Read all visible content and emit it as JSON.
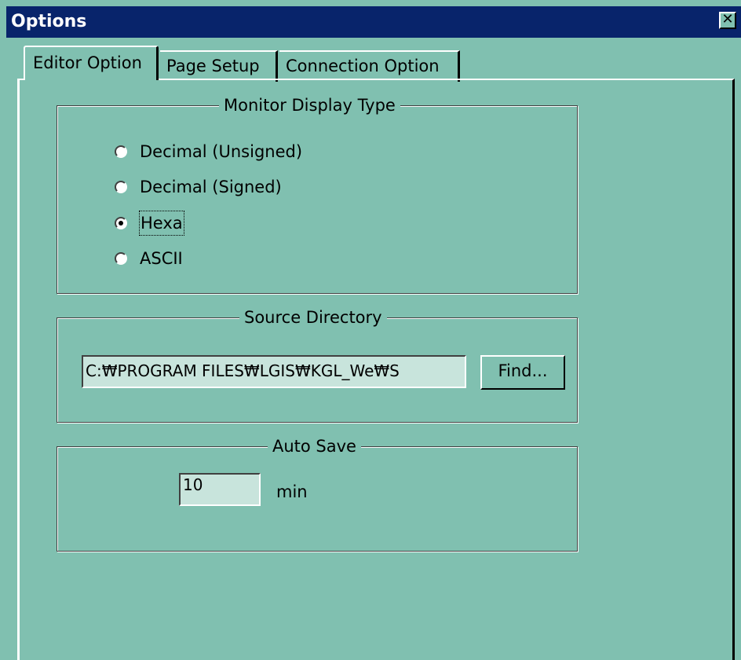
{
  "window": {
    "title": "Options"
  },
  "tabs": [
    {
      "label": "Editor Option",
      "active": true
    },
    {
      "label": "Page Setup",
      "active": false
    },
    {
      "label": "Connection Option",
      "active": false
    }
  ],
  "monitor_display": {
    "legend": "Monitor Display Type",
    "options": [
      {
        "label": "Decimal (Unsigned)",
        "checked": false
      },
      {
        "label": "Decimal (Signed)",
        "checked": false
      },
      {
        "label": "Hexa",
        "checked": true
      },
      {
        "label": "ASCII",
        "checked": false
      }
    ]
  },
  "source_directory": {
    "legend": "Source Directory",
    "path_value": "C:₩PROGRAM FILES₩LGIS₩KGL_We₩S",
    "find_label": "Find..."
  },
  "auto_save": {
    "legend": "Auto Save",
    "minutes_value": "10",
    "unit_label": "min"
  },
  "colors": {
    "dialog_bg": "#80c0b0",
    "titlebar": "#08246b",
    "field_bg": "#c8e4dc"
  }
}
